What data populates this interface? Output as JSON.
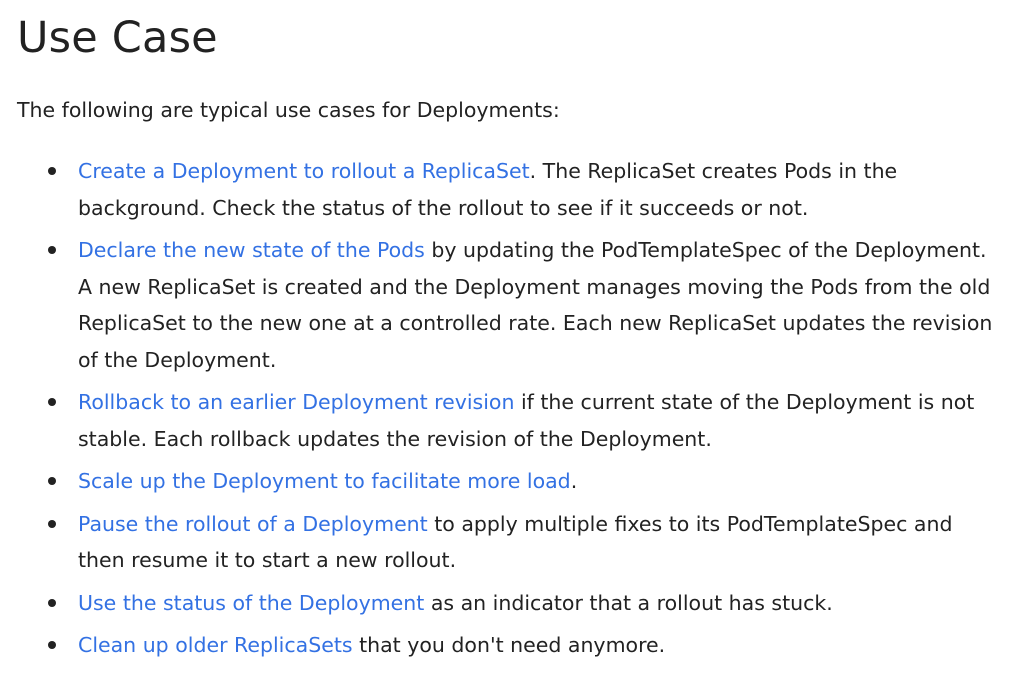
{
  "heading": "Use Case",
  "intro": "The following are typical use cases for Deployments:",
  "colors": {
    "link": "#3371e3",
    "text": "#222222"
  },
  "items": [
    {
      "link": "Create a Deployment to rollout a ReplicaSet",
      "text": ". The ReplicaSet creates Pods in the background. Check the status of the rollout to see if it succeeds or not."
    },
    {
      "link": "Declare the new state of the Pods",
      "text": " by updating the PodTemplateSpec of the Deployment. A new ReplicaSet is created and the Deployment manages moving the Pods from the old ReplicaSet to the new one at a controlled rate. Each new ReplicaSet updates the revision of the Deployment."
    },
    {
      "link": "Rollback to an earlier Deployment revision",
      "text": " if the current state of the Deployment is not stable. Each rollback updates the revision of the Deployment."
    },
    {
      "link": "Scale up the Deployment to facilitate more load",
      "text": "."
    },
    {
      "link": "Pause the rollout of a Deployment",
      "text": " to apply multiple fixes to its PodTemplateSpec and then resume it to start a new rollout."
    },
    {
      "link": "Use the status of the Deployment",
      "text": " as an indicator that a rollout has stuck."
    },
    {
      "link": "Clean up older ReplicaSets",
      "text": " that you don't need anymore."
    }
  ]
}
